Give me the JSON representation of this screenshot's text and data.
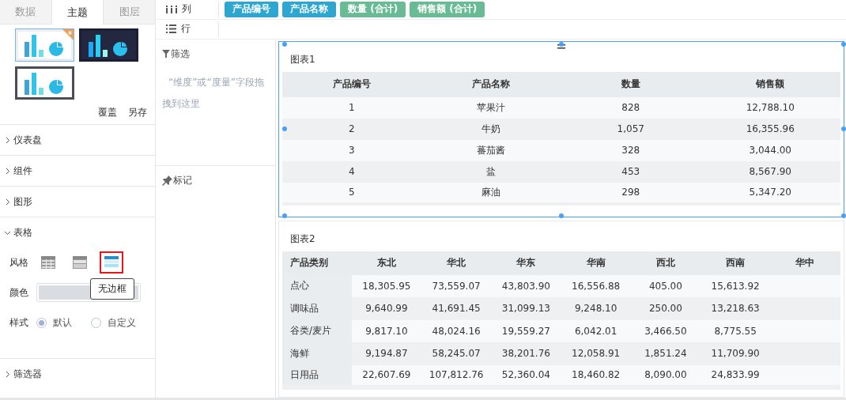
{
  "tabs": [
    {
      "label": "数据",
      "selected": false
    },
    {
      "label": "主题",
      "selected": true
    },
    {
      "label": "图层",
      "selected": false
    }
  ],
  "themes": [
    {
      "kind": "light",
      "selected": true,
      "starred": true
    },
    {
      "kind": "dark",
      "selected": false,
      "starred": false
    },
    {
      "kind": "outlined",
      "selected": false,
      "starred": false
    }
  ],
  "theme_actions": [
    "覆盖",
    "另存"
  ],
  "sections": [
    {
      "title": "仪表盘",
      "expanded": false
    },
    {
      "title": "组件",
      "expanded": false
    },
    {
      "title": "图形",
      "expanded": false
    },
    {
      "title": "表格",
      "expanded": true
    },
    {
      "title": "筛选器",
      "expanded": false
    }
  ],
  "table_settings": {
    "style_label": "风格",
    "styles": [
      {
        "kind": "grid",
        "selected": false
      },
      {
        "kind": "striped",
        "selected": false
      },
      {
        "kind": "borderless",
        "selected": true
      }
    ],
    "tooltip": "无边框",
    "color_label": "颜色",
    "format_label": "样式",
    "formats": [
      {
        "label": "默认",
        "selected": true
      },
      {
        "label": "自定义",
        "selected": false
      }
    ]
  },
  "shelves": [
    {
      "kind": "columns",
      "label": "列",
      "pills": [
        {
          "label": "产品编号",
          "kind": "dimension"
        },
        {
          "label": "产品名称",
          "kind": "dimension"
        },
        {
          "label": "数量 (合计)",
          "kind": "measure"
        },
        {
          "label": "销售额 (合计)",
          "kind": "measure"
        }
      ]
    },
    {
      "kind": "rows",
      "label": "行"
    }
  ],
  "filter": {
    "title": "筛选",
    "hint": "“维度”或“度量”字段拖拽到这里"
  },
  "marks": {
    "title": "标记"
  },
  "charts": [
    {
      "title": "图表1",
      "selected": true,
      "row_header": false,
      "columns": [
        "产品编号",
        "产品名称",
        "数量",
        "销售额"
      ],
      "rows": [
        [
          "1",
          "苹果汁",
          "828",
          "12,788.10"
        ],
        [
          "2",
          "牛奶",
          "1,057",
          "16,355.96"
        ],
        [
          "3",
          "蕃茄酱",
          "328",
          "3,044.00"
        ],
        [
          "4",
          "盐",
          "453",
          "8,567.90"
        ],
        [
          "5",
          "麻油",
          "298",
          "5,347.20"
        ]
      ]
    },
    {
      "title": "图表2",
      "selected": false,
      "row_header": true,
      "columns": [
        "产品类别",
        "东北",
        "华北",
        "华东",
        "华南",
        "西北",
        "西南",
        "华中"
      ],
      "rows": [
        [
          "点心",
          "18,305.95",
          "73,559.07",
          "43,803.90",
          "16,556.88",
          "405.00",
          "15,613.92",
          ""
        ],
        [
          "调味品",
          "9,640.99",
          "41,691.45",
          "31,099.13",
          "9,248.10",
          "250.00",
          "13,218.63",
          ""
        ],
        [
          "谷类/麦片",
          "9,817.10",
          "48,024.16",
          "19,559.27",
          "6,042.01",
          "3,466.50",
          "8,775.55",
          ""
        ],
        [
          "海鲜",
          "9,194.87",
          "58,245.07",
          "38,201.76",
          "12,058.91",
          "1,851.24",
          "11,709.90",
          ""
        ],
        [
          "日用品",
          "22,607.69",
          "107,812.76",
          "52,360.04",
          "18,460.82",
          "8,090.00",
          "24,833.99",
          ""
        ]
      ]
    }
  ]
}
